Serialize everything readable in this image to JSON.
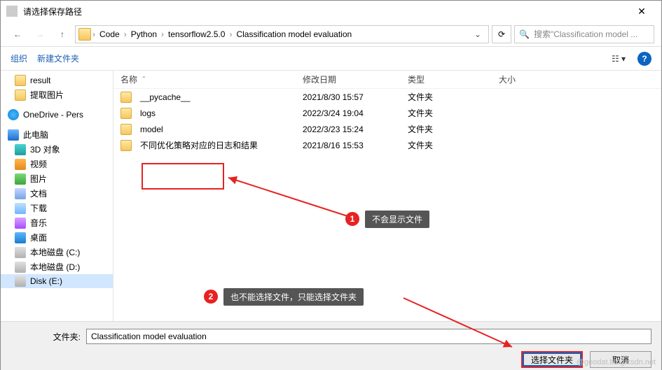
{
  "window": {
    "title": "请选择保存路径"
  },
  "breadcrumbs": [
    "Code",
    "Python",
    "tensorflow2.5.0",
    "Classification model evaluation"
  ],
  "search_placeholder": "搜索\"Classification model ...",
  "toolbar": {
    "organize": "组织",
    "newfolder": "新建文件夹"
  },
  "columns": {
    "name": "名称",
    "date": "修改日期",
    "type": "类型",
    "size": "大小"
  },
  "sidebar": [
    {
      "label": "result",
      "icon": "ic-folder"
    },
    {
      "label": "提取图片",
      "icon": "ic-folder"
    },
    {
      "label": "OneDrive - Pers",
      "icon": "ic-onedrive",
      "indent": 10
    },
    {
      "label": "此电脑",
      "icon": "ic-pc",
      "indent": 10
    },
    {
      "label": "3D 对象",
      "icon": "ic-3d"
    },
    {
      "label": "视频",
      "icon": "ic-video"
    },
    {
      "label": "图片",
      "icon": "ic-pic"
    },
    {
      "label": "文档",
      "icon": "ic-doc"
    },
    {
      "label": "下载",
      "icon": "ic-dl"
    },
    {
      "label": "音乐",
      "icon": "ic-music"
    },
    {
      "label": "桌面",
      "icon": "ic-desk"
    },
    {
      "label": "本地磁盘 (C:)",
      "icon": "ic-disk"
    },
    {
      "label": "本地磁盘 (D:)",
      "icon": "ic-disk"
    },
    {
      "label": "Disk (E:)",
      "icon": "ic-disk",
      "sel": true
    }
  ],
  "files": [
    {
      "name": "__pycache__",
      "date": "2021/8/30 15:57",
      "type": "文件夹"
    },
    {
      "name": "logs",
      "date": "2022/3/24 19:04",
      "type": "文件夹"
    },
    {
      "name": "model",
      "date": "2022/3/23 15:24",
      "type": "文件夹"
    },
    {
      "name": "不同优化策略对应的日志和结果",
      "date": "2021/8/16 15:53",
      "type": "文件夹"
    }
  ],
  "footer": {
    "label": "文件夹:",
    "value": "Classification model evaluation",
    "ok": "选择文件夹",
    "cancel": "取消"
  },
  "annotations": {
    "n1": "1",
    "t1": "不会显示文件",
    "n2": "2",
    "t2": "也不能选择文件，只能选择文件夹"
  },
  "watermark": "@geodat.blog.csdn.net"
}
